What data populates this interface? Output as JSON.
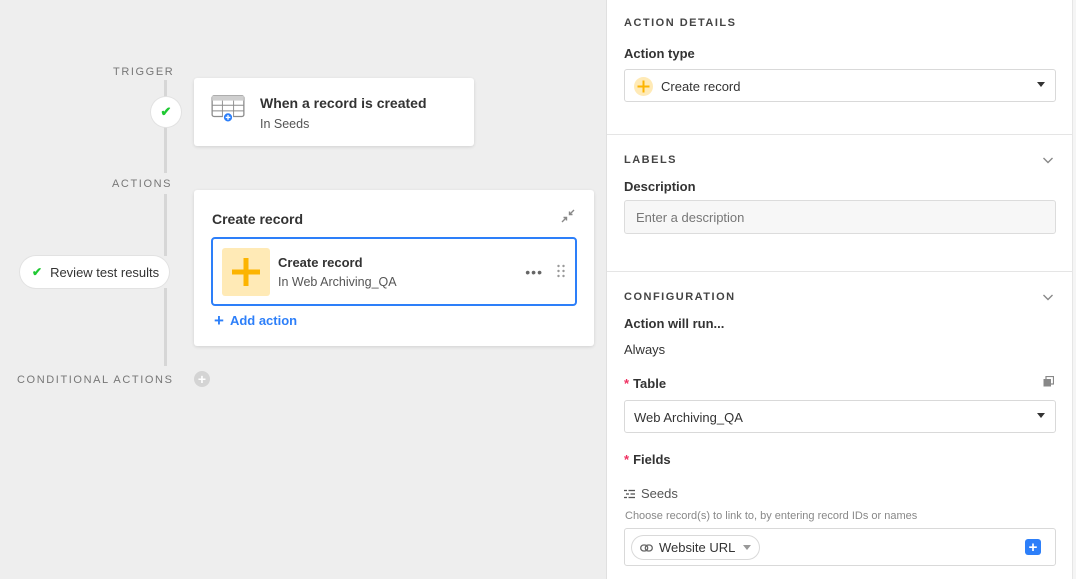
{
  "canvas": {
    "trigger_label": "TRIGGER",
    "actions_label": "ACTIONS",
    "conditional_label": "CONDITIONAL ACTIONS",
    "trigger": {
      "title": "When a record is created",
      "subtitle": "In Seeds",
      "icon": "table-add-icon",
      "status_icon": "check-icon"
    },
    "actions": {
      "title": "Create record",
      "item": {
        "name": "Create record",
        "subtitle": "In Web Archiving_QA",
        "icon": "plus-icon",
        "more": "•••"
      },
      "add_action": "Add action"
    },
    "review": {
      "label": "Review test results",
      "icon": "check-icon"
    },
    "conditional_add": "+"
  },
  "panel": {
    "action_details": {
      "title": "ACTION DETAILS",
      "action_type_label": "Action type",
      "action_type_value": "Create record"
    },
    "labels": {
      "title": "LABELS",
      "description_label": "Description",
      "description_placeholder": "Enter a description",
      "description_value": ""
    },
    "configuration": {
      "title": "CONFIGURATION",
      "runs_label": "Action will run...",
      "runs_value": "Always",
      "required_mark": "*",
      "table_label": "Table",
      "table_value": "Web Archiving_QA",
      "fields_label": "Fields",
      "field_name": "Seeds",
      "field_hint": "Choose record(s) to link to, by entering record IDs or names",
      "chip_label": "Website URL",
      "add_button": "+"
    }
  },
  "colors": {
    "accent_blue": "#2d7ff9",
    "success_green": "#20c933",
    "create_yellow": "#fcb400",
    "create_tile_bg": "#ffeab6",
    "required_red": "#ef3061",
    "canvas_bg": "#eeeeee"
  }
}
